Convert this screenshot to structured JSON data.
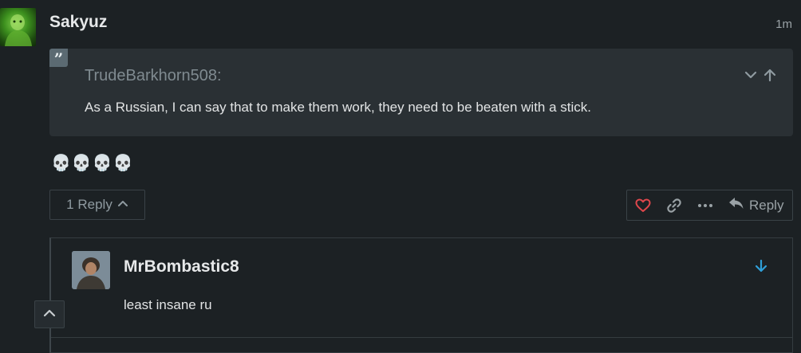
{
  "post": {
    "username": "Sakyuz",
    "timestamp": "1m",
    "quote": {
      "author": "TrudeBarkhorn508:",
      "text": "As a Russian, I can say that to make them work, they need to be beaten with a stick."
    },
    "text": "💀💀💀💀",
    "replies_toggle": "1 Reply",
    "actions": {
      "reply_label": "Reply",
      "like_color": "#e0474c"
    }
  },
  "reply": {
    "username": "MrBombastic8",
    "text": "least insane ru",
    "accent_color": "#2f9fd8"
  }
}
